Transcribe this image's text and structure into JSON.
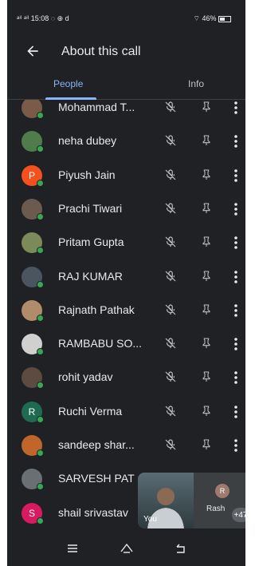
{
  "status": {
    "left": "ᵃⁱˡ ᵃⁱˡ 15:08 ◌ ⊕ d",
    "right": "⌔ 46% "
  },
  "header": {
    "title": "About this call"
  },
  "tabs": [
    {
      "label": "People"
    },
    {
      "label": "Info"
    }
  ],
  "participants": [
    {
      "name": "Mohammad T...",
      "initial": "",
      "color": "#7a5a48"
    },
    {
      "name": "neha dubey",
      "initial": "",
      "color": "#4f7c4a"
    },
    {
      "name": "Piyush Jain",
      "initial": "P",
      "color": "#f4511e"
    },
    {
      "name": "Prachi Tiwari",
      "initial": "",
      "color": "#6b5a4e"
    },
    {
      "name": "Pritam Gupta",
      "initial": "",
      "color": "#7c8a5a"
    },
    {
      "name": "RAJ KUMAR",
      "initial": "",
      "color": "#4a5560"
    },
    {
      "name": "Rajnath Pathak",
      "initial": "",
      "color": "#b08c6a"
    },
    {
      "name": "RAMBABU SO...",
      "initial": "",
      "color": "#d0d0d0"
    },
    {
      "name": "rohit yadav",
      "initial": "",
      "color": "#5d4a40"
    },
    {
      "name": "Ruchi Verma",
      "initial": "R",
      "color": "#1e6b52"
    },
    {
      "name": "sandeep shar...",
      "initial": "",
      "color": "#c0662a"
    },
    {
      "name": "SARVESH PAT",
      "initial": "",
      "color": "#6a6f74"
    },
    {
      "name": "shail srivastav",
      "initial": "S",
      "color": "#d81b60"
    }
  ],
  "selfview": {
    "you_label": "You",
    "other_initial": "R",
    "other_label": "Rash",
    "count": "+47"
  }
}
